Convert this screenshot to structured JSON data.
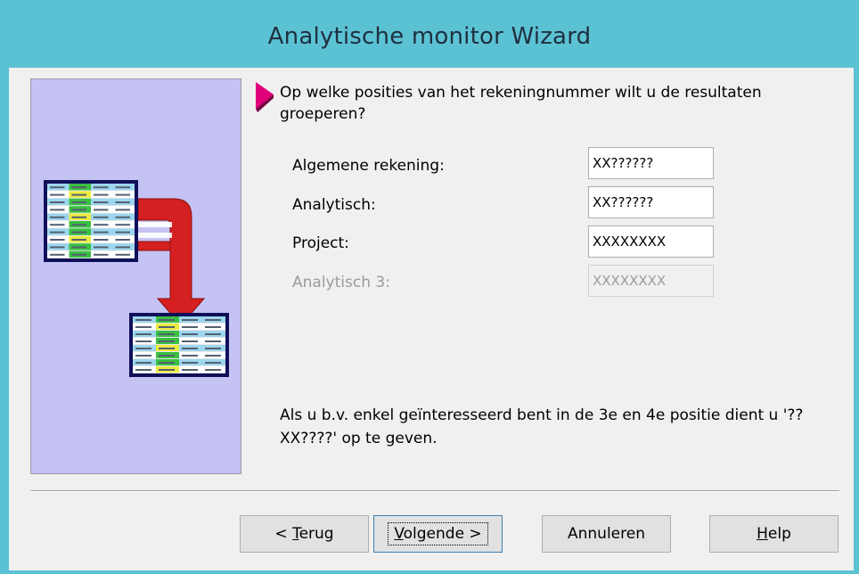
{
  "window": {
    "title": "Analytische monitor Wizard"
  },
  "colors": {
    "frame": "#5bc2d4",
    "illustration_bg": "#c5c2f4",
    "arrow": "#e0007a",
    "flow_arrow": "#d42020"
  },
  "question": "Op welke posities van het rekeningnummer wilt u de resultaten groeperen?",
  "fields": [
    {
      "label": "Algemene rekening:",
      "value": "XX??????",
      "enabled": true
    },
    {
      "label": "Analytisch:",
      "value": "XX??????",
      "enabled": true
    },
    {
      "label": "Project:",
      "value": "XXXXXXXX",
      "enabled": true
    },
    {
      "label": "Analytisch 3:",
      "value": "XXXXXXXX",
      "enabled": false
    }
  ],
  "note": "Als u b.v. enkel geïnteresseerd bent in de 3e en 4e positie dient u '??XX????' op te geven.",
  "buttons": {
    "back": {
      "prefix": "< ",
      "mnemonic": "T",
      "rest": "erug"
    },
    "next": {
      "mnemonic": "V",
      "rest": "olgende >"
    },
    "cancel": {
      "label": "Annuleren"
    },
    "help": {
      "mnemonic": "H",
      "rest": "elp"
    }
  },
  "icons": {
    "prompt": "triangle-pointer-icon",
    "illustration": "merge-tables-illustration"
  }
}
